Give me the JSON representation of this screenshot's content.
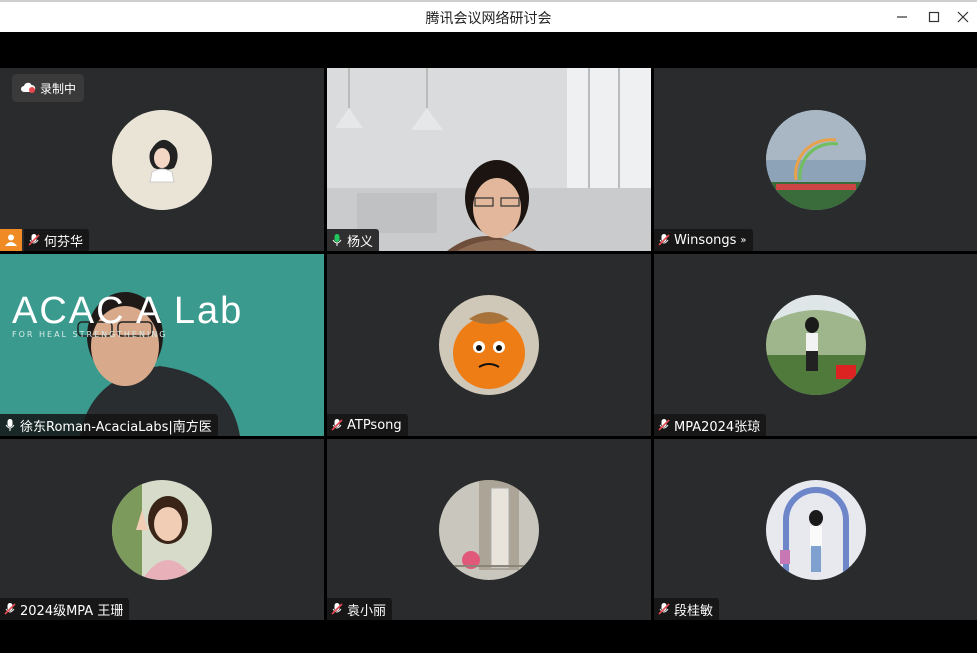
{
  "window": {
    "title": "腾讯会议网络研讨会",
    "minimize_icon": "minimize-icon",
    "maximize_icon": "maximize-icon",
    "close_icon": "close-icon"
  },
  "recording": {
    "label": "录制中",
    "icon": "cloud-record-icon"
  },
  "participants": [
    {
      "name": "何芬华",
      "mic": "muted",
      "video": false,
      "host": true
    },
    {
      "name": "杨义",
      "mic": "active",
      "video": true,
      "speaking": true
    },
    {
      "name": "Winsongs",
      "mic": "muted",
      "video": false
    },
    {
      "name": "徐东Roman-AcaciaLabs|南方医",
      "mic": "active",
      "video": true,
      "background_text": "ACAC A Lab",
      "background_sub": "FOR HEAL    STRENGTHENING"
    },
    {
      "name": "ATPsong",
      "mic": "muted",
      "video": false
    },
    {
      "name": "MPA2024张琼",
      "mic": "muted",
      "video": false
    },
    {
      "name": "2024级MPA 王珊",
      "mic": "muted",
      "video": false
    },
    {
      "name": "袁小丽",
      "mic": "muted",
      "video": false
    },
    {
      "name": "段桂敏",
      "mic": "muted",
      "video": false
    }
  ],
  "colors": {
    "tile_bg": "#2a2b2d",
    "speaking_border": "#22c55e",
    "host_badge": "#f08a24",
    "muted_icon": "#e5484d",
    "lab_bg": "#3a9a8e"
  }
}
